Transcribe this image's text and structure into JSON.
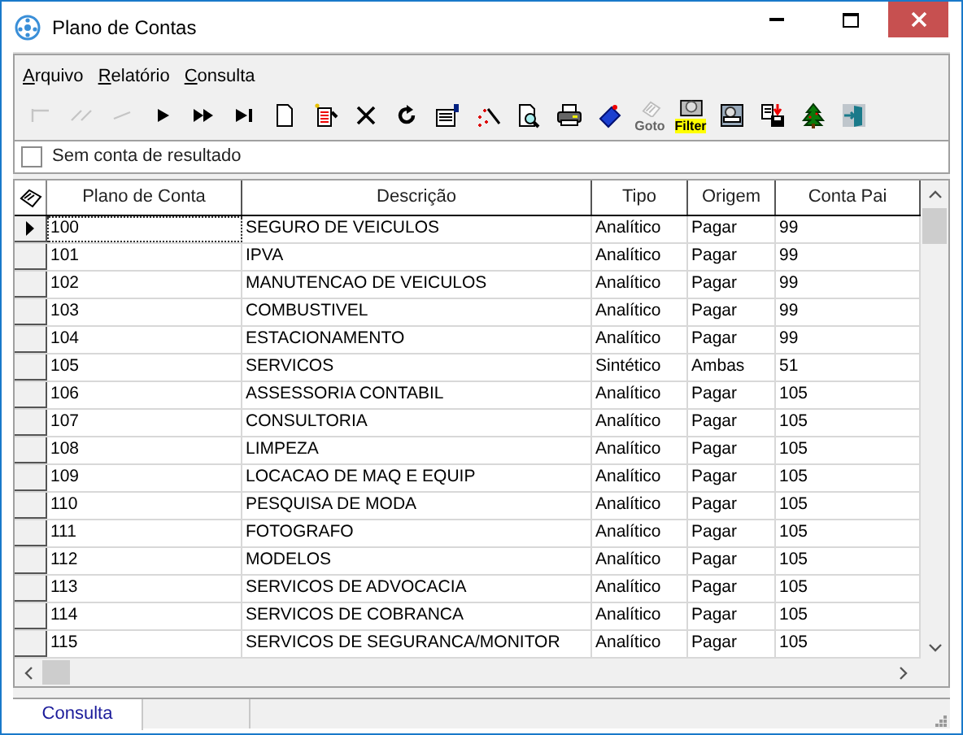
{
  "window": {
    "title": "Plano de Contas"
  },
  "menu": [
    "Arquivo",
    "Relatório",
    "Consulta"
  ],
  "toolbar": [
    {
      "disabled": true
    },
    {
      "disabled": true
    },
    {
      "disabled": true
    },
    {
      "disabled": false
    },
    {
      "disabled": false
    },
    {
      "disabled": false
    },
    {
      "disabled": false
    },
    {
      "disabled": false
    },
    {
      "disabled": false
    },
    {
      "disabled": false
    },
    {
      "disabled": false
    },
    {
      "disabled": false
    },
    {
      "disabled": false
    },
    {
      "disabled": false
    },
    {
      "disabled": false
    },
    {
      "label": "Goto",
      "disabled": true
    },
    {
      "label": "Filter",
      "disabled": false
    },
    {
      "disabled": false
    },
    {
      "disabled": false
    },
    {
      "disabled": false
    },
    {
      "disabled": false
    }
  ],
  "filter_checkbox": {
    "label": "Sem conta de resultado",
    "checked": false
  },
  "table": {
    "columns": [
      "Plano de Conta",
      "Descrição",
      "Tipo",
      "Origem",
      "Conta Pai"
    ],
    "rows": [
      {
        "cells": [
          "100",
          "SEGURO DE VEICULOS",
          "Analítico",
          "Pagar",
          "99"
        ],
        "selected": true
      },
      {
        "cells": [
          "101",
          "IPVA",
          "Analítico",
          "Pagar",
          "99"
        ],
        "selected": false
      },
      {
        "cells": [
          "102",
          "MANUTENCAO DE VEICULOS",
          "Analítico",
          "Pagar",
          "99"
        ],
        "selected": false
      },
      {
        "cells": [
          "103",
          "COMBUSTIVEL",
          "Analítico",
          "Pagar",
          "99"
        ],
        "selected": false
      },
      {
        "cells": [
          "104",
          "ESTACIONAMENTO",
          "Analítico",
          "Pagar",
          "99"
        ],
        "selected": false
      },
      {
        "cells": [
          "105",
          "SERVICOS",
          "Sintético",
          "Ambas",
          "51"
        ],
        "selected": false
      },
      {
        "cells": [
          "106",
          "ASSESSORIA CONTABIL",
          "Analítico",
          "Pagar",
          "105"
        ],
        "selected": false
      },
      {
        "cells": [
          "107",
          "CONSULTORIA",
          "Analítico",
          "Pagar",
          "105"
        ],
        "selected": false
      },
      {
        "cells": [
          "108",
          "LIMPEZA",
          "Analítico",
          "Pagar",
          "105"
        ],
        "selected": false
      },
      {
        "cells": [
          "109",
          "LOCACAO DE MAQ E EQUIP",
          "Analítico",
          "Pagar",
          "105"
        ],
        "selected": false
      },
      {
        "cells": [
          "110",
          "PESQUISA DE MODA",
          "Analítico",
          "Pagar",
          "105"
        ],
        "selected": false
      },
      {
        "cells": [
          "111",
          "FOTOGRAFO",
          "Analítico",
          "Pagar",
          "105"
        ],
        "selected": false
      },
      {
        "cells": [
          "112",
          "MODELOS",
          "Analítico",
          "Pagar",
          "105"
        ],
        "selected": false
      },
      {
        "cells": [
          "113",
          "SERVICOS DE ADVOCACIA",
          "Analítico",
          "Pagar",
          "105"
        ],
        "selected": false
      },
      {
        "cells": [
          "114",
          "SERVICOS DE COBRANCA",
          "Analítico",
          "Pagar",
          "105"
        ],
        "selected": false
      },
      {
        "cells": [
          "115",
          "SERVICOS DE SEGURANCA/MONITOR",
          "Analítico",
          "Pagar",
          "105"
        ],
        "selected": false
      }
    ]
  },
  "status_bar": {
    "tabs": [
      {
        "label": "Consulta",
        "selected": true
      }
    ]
  }
}
